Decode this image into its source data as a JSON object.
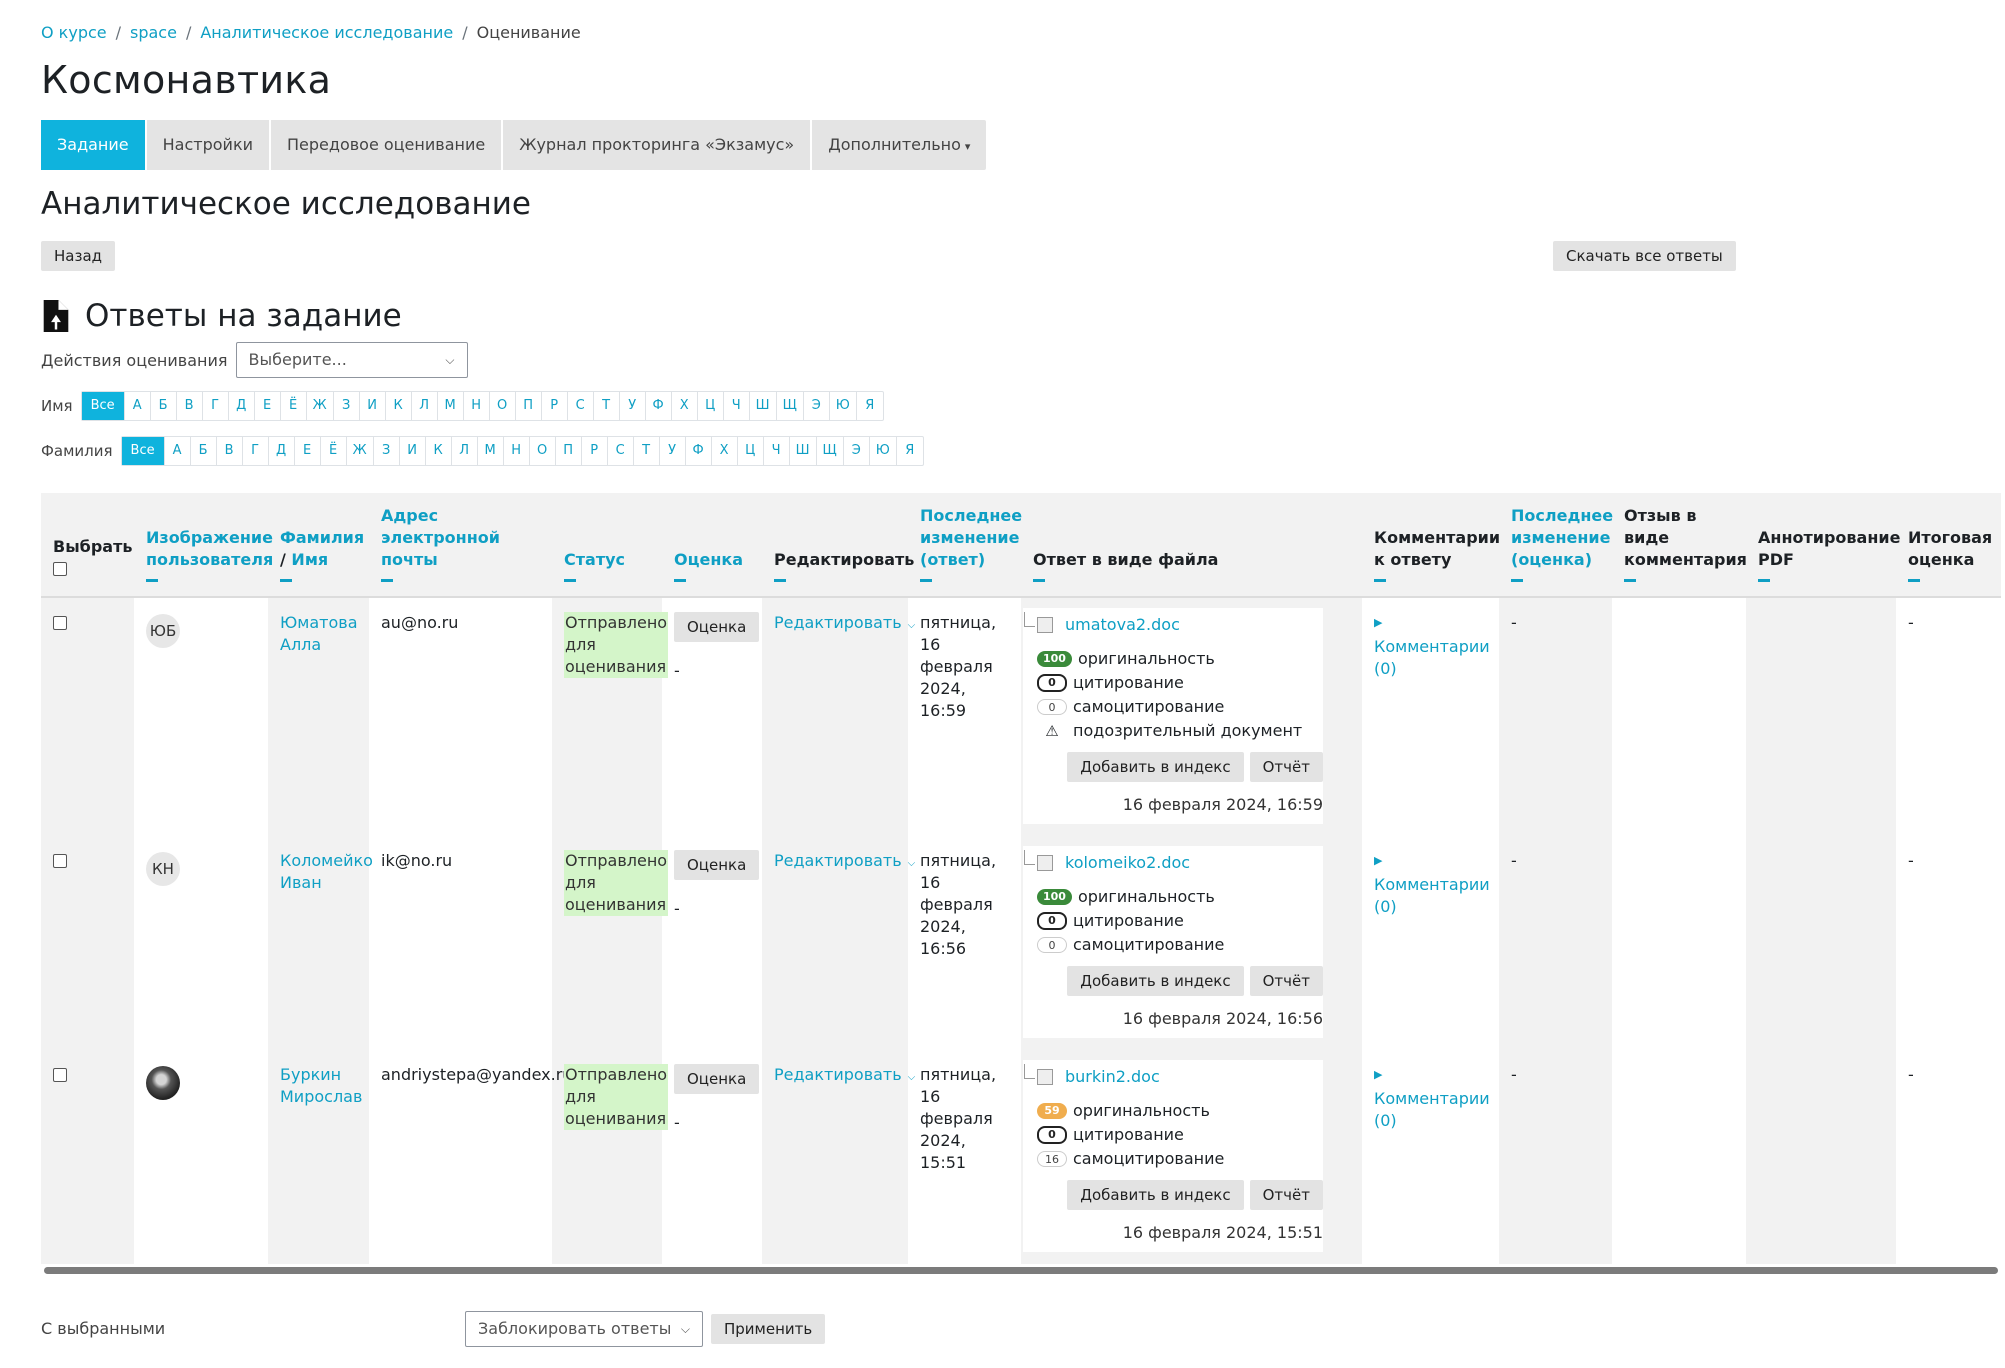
{
  "breadcrumb": [
    "О курсе",
    "space",
    "Аналитическое исследование",
    "Оценивание"
  ],
  "course_title": "Космонавтика",
  "tabs": [
    {
      "label": "Задание",
      "active": true
    },
    {
      "label": "Настройки",
      "active": false
    },
    {
      "label": "Передовое оценивание",
      "active": false
    },
    {
      "label": "Журнал прокторинга «Экзамус»",
      "active": false
    },
    {
      "label": "Дополнительно",
      "active": false
    }
  ],
  "assignment_title": "Аналитическое исследование",
  "back_label": "Назад",
  "download_label": "Скачать все ответы",
  "answers_heading": "Ответы на задание",
  "grading_actions": {
    "label": "Действия оценивания",
    "placeholder": "Выберите..."
  },
  "initials": {
    "first_label": "Имя",
    "last_label": "Фамилия",
    "all_label": "Все",
    "letters": [
      "А",
      "Б",
      "В",
      "Г",
      "Д",
      "Е",
      "Ё",
      "Ж",
      "З",
      "И",
      "К",
      "Л",
      "М",
      "Н",
      "О",
      "П",
      "Р",
      "С",
      "Т",
      "У",
      "Ф",
      "Х",
      "Ц",
      "Ч",
      "Ш",
      "Щ",
      "Э",
      "Ю",
      "Я"
    ]
  },
  "columns": {
    "select": "Выбрать",
    "picture": "Изображение пользователя",
    "lastname": "Фамилия",
    "firstname": "Имя",
    "email": "Адрес электронной почты",
    "status": "Статус",
    "grade": "Оценка",
    "edit": "Редактировать",
    "last_modified_submission": "Последнее изменение (ответ)",
    "file_submission": "Ответ в виде файла",
    "submission_comments": "Комментарии к ответу",
    "last_modified_grade": "Последнее изменение (оценка)",
    "feedback_comments": "Отзыв в виде комментария",
    "annotate_pdf": "Аннотирование PDF",
    "final_grade": "Итоговая оценка"
  },
  "row_labels": {
    "grade_button": "Оценка",
    "edit_link": "Редактировать",
    "originality": "оригинальность",
    "citation": "цитирование",
    "self_citation": "самоцитирование",
    "suspicious": "подозрительный документ",
    "add_to_index": "Добавить в индекс",
    "report": "Отчёт",
    "comments": "Комментарии (0)",
    "dash": "-",
    "status": "Отправлено для оценивания"
  },
  "rows": [
    {
      "initials": "ЮБ",
      "name": "Юматова Алла",
      "email": "au@no.ru",
      "grade_value": "-",
      "modified": "пятница, 16 февраля 2024, 16:59",
      "file": "umatova2.doc",
      "originality": "100",
      "citation": "0",
      "self_citation": "0",
      "file_date": "16 февраля 2024, 16:59",
      "suspicious": true
    },
    {
      "initials": "КН",
      "name": "Коломейко Иван",
      "email": "ik@no.ru",
      "grade_value": "-",
      "modified": "пятница, 16 февраля 2024, 16:56",
      "file": "kolomeiko2.doc",
      "originality": "100",
      "citation": "0",
      "self_citation": "0",
      "file_date": "16 февраля 2024, 16:56",
      "suspicious": false
    },
    {
      "initials": "",
      "name": "Буркин Мирослав",
      "email": "andriystepa@yandex.ru",
      "grade_value": "-",
      "modified": "пятница, 16 февраля 2024, 15:51",
      "file": "burkin2.doc",
      "originality": "59",
      "citation": "0",
      "self_citation": "16",
      "file_date": "16 февраля 2024, 15:51",
      "suspicious": false
    }
  ],
  "bulk": {
    "label": "С выбранными",
    "option": "Заблокировать ответы",
    "apply": "Применить"
  },
  "colors": {
    "accent": "#0fb3dd",
    "link": "#0f9fc4",
    "status_bg": "#d4f5c9",
    "badge_green": "#3a8a3a",
    "badge_orange": "#f0ad4e"
  }
}
